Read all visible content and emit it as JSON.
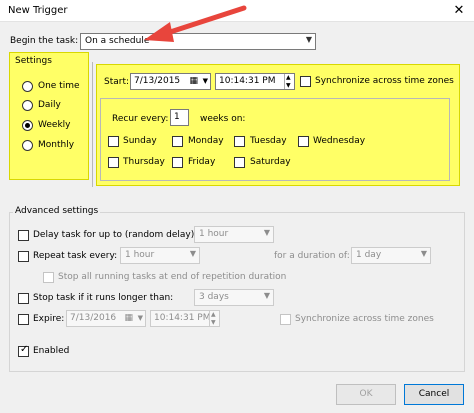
{
  "window": {
    "title": "New Trigger",
    "close": "✕"
  },
  "begin": {
    "label": "Begin the task:",
    "value": "On a schedule"
  },
  "settings": {
    "title": "Settings",
    "radios": [
      {
        "label": "One time",
        "checked": false
      },
      {
        "label": "Daily",
        "checked": false
      },
      {
        "label": "Weekly",
        "checked": true
      },
      {
        "label": "Monthly",
        "checked": false
      }
    ],
    "start_label": "Start:",
    "start_date": "7/13/2015",
    "start_time": "10:14:31 PM",
    "sync_label": "Synchronize across time zones",
    "recur_label": "Recur every:",
    "recur_value": "1",
    "recur_suffix": "weeks on:",
    "days": [
      "Sunday",
      "Monday",
      "Tuesday",
      "Wednesday",
      "Thursday",
      "Friday",
      "Saturday"
    ]
  },
  "advanced": {
    "title": "Advanced settings",
    "delay_label": "Delay task for up to (random delay):",
    "delay_value": "1 hour",
    "repeat_label": "Repeat task every:",
    "repeat_value": "1 hour",
    "duration_label": "for a duration of:",
    "duration_value": "1 day",
    "stop_running_label": "Stop all running tasks at end of repetition duration",
    "stop_longer_label": "Stop task if it runs longer than:",
    "stop_longer_value": "3 days",
    "expire_label": "Expire:",
    "expire_date": "7/13/2016",
    "expire_time": "10:14:31 PM",
    "expire_sync_label": "Synchronize across time zones",
    "enabled_label": "Enabled",
    "enabled_checked": true
  },
  "buttons": {
    "ok": "OK",
    "cancel": "Cancel"
  },
  "colors": {
    "highlight": "#ffff66",
    "arrow": "#e8453c"
  }
}
